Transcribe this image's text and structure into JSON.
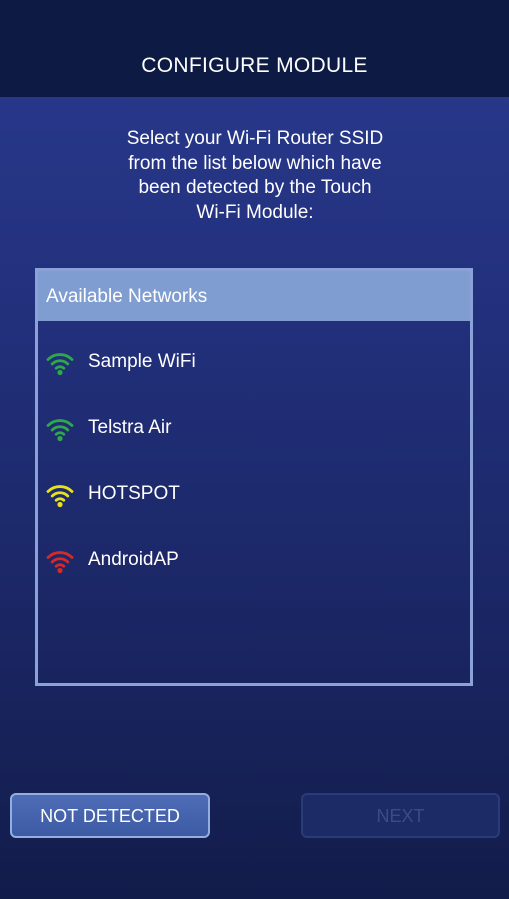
{
  "header": {
    "title": "CONFIGURE MODULE"
  },
  "instructions": {
    "lines": [
      "Select your Wi-Fi Router SSID",
      "from the list below which have",
      "been detected by the Touch",
      "Wi-Fi Module:"
    ]
  },
  "networks": {
    "header_label": "Available Networks",
    "items": [
      {
        "name": "Sample WiFi",
        "icon": "wifi-icon",
        "signal_color": "#2ea84a"
      },
      {
        "name": "Telstra Air",
        "icon": "wifi-icon",
        "signal_color": "#2ea84a"
      },
      {
        "name": "HOTSPOT",
        "icon": "wifi-icon",
        "signal_color": "#e8e21a"
      },
      {
        "name": "AndroidAP",
        "icon": "wifi-icon",
        "signal_color": "#d42a2a"
      }
    ]
  },
  "buttons": {
    "not_detected_label": "NOT DETECTED",
    "next_label": "NEXT"
  }
}
